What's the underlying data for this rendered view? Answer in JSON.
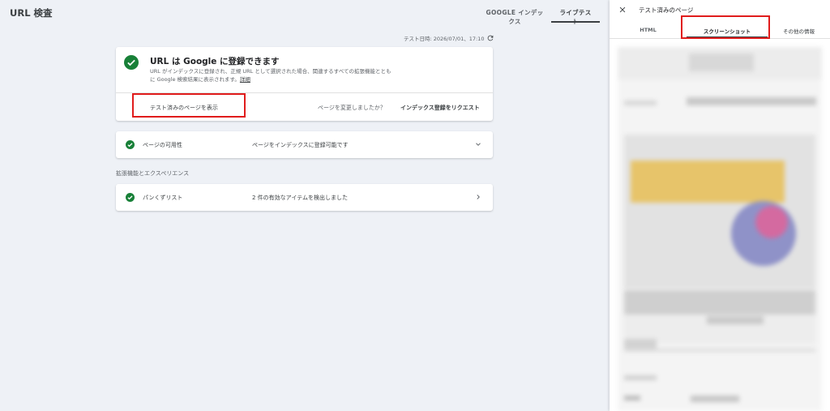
{
  "header": {
    "title": "URL 検査",
    "tabs": [
      {
        "label": "GOOGLE インデックス",
        "active": false
      },
      {
        "label": "ライブテスト",
        "active": true
      }
    ]
  },
  "test_time": "テスト日時: 2026/07/01、17:10",
  "main_card": {
    "heading": "URL は Google に登録できます",
    "description": "URL がインデックスに登録され、正規 URL として選択された場合、関連するすべての拡張機能とともに Google 検索結果に表示されます。",
    "detail_link": "詳細",
    "view_tested_page": "テスト済みのページを表示",
    "changed_question": "ページを変更しましたか？",
    "request_indexing": "インデックス登録をリクエスト"
  },
  "availability": {
    "label": "ページの可用性",
    "value": "ページをインデックスに登録可能です"
  },
  "enhancements": {
    "section_label": "拡張機能とエクスペリエンス",
    "breadcrumb_label": "パンくずリスト",
    "breadcrumb_value": "2 件の有効なアイテムを検出しました"
  },
  "panel": {
    "title": "テスト済みのページ",
    "tabs": [
      {
        "label": "HTML",
        "active": false
      },
      {
        "label": "スクリーンショット",
        "active": true
      },
      {
        "label": "その他の情報",
        "active": false
      }
    ]
  },
  "colors": {
    "success_green": "#188038",
    "highlight_red": "#e01c1c",
    "background": "#eef1f6"
  }
}
